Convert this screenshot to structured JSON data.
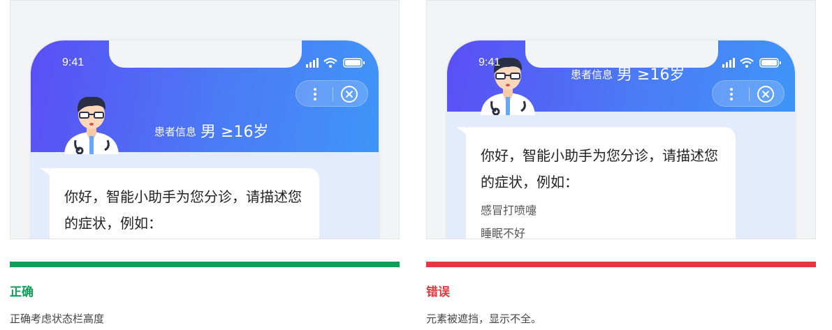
{
  "colors": {
    "correct": "#0aa05a",
    "wrong": "#e0393e",
    "header_start": "#5a4ff4",
    "header_end": "#3f95f7",
    "chat_bg": "#e3ecfc"
  },
  "icons": [
    "signal-icon",
    "wifi-icon",
    "battery-icon",
    "more-icon",
    "close-circle-icon",
    "doctor-avatar-icon"
  ],
  "panels": [
    {
      "status_time": "9:41",
      "patient_label": "患者信息",
      "patient_value": "男 ≥16岁",
      "message": "你好，智能小助手为您分诊，请描述您的症状，例如：",
      "examples": [],
      "verdict": "正确",
      "description": "正确考虑状态栏高度"
    },
    {
      "status_time": "9:41",
      "patient_label": "患者信息",
      "patient_value": "男 ≥16岁",
      "message": "你好，智能小助手为您分诊，请描述您的症状，例如：",
      "examples": [
        "感冒打喷嚏",
        "睡眠不好"
      ],
      "verdict": "错误",
      "description": "元素被遮挡，显示不全。"
    }
  ]
}
